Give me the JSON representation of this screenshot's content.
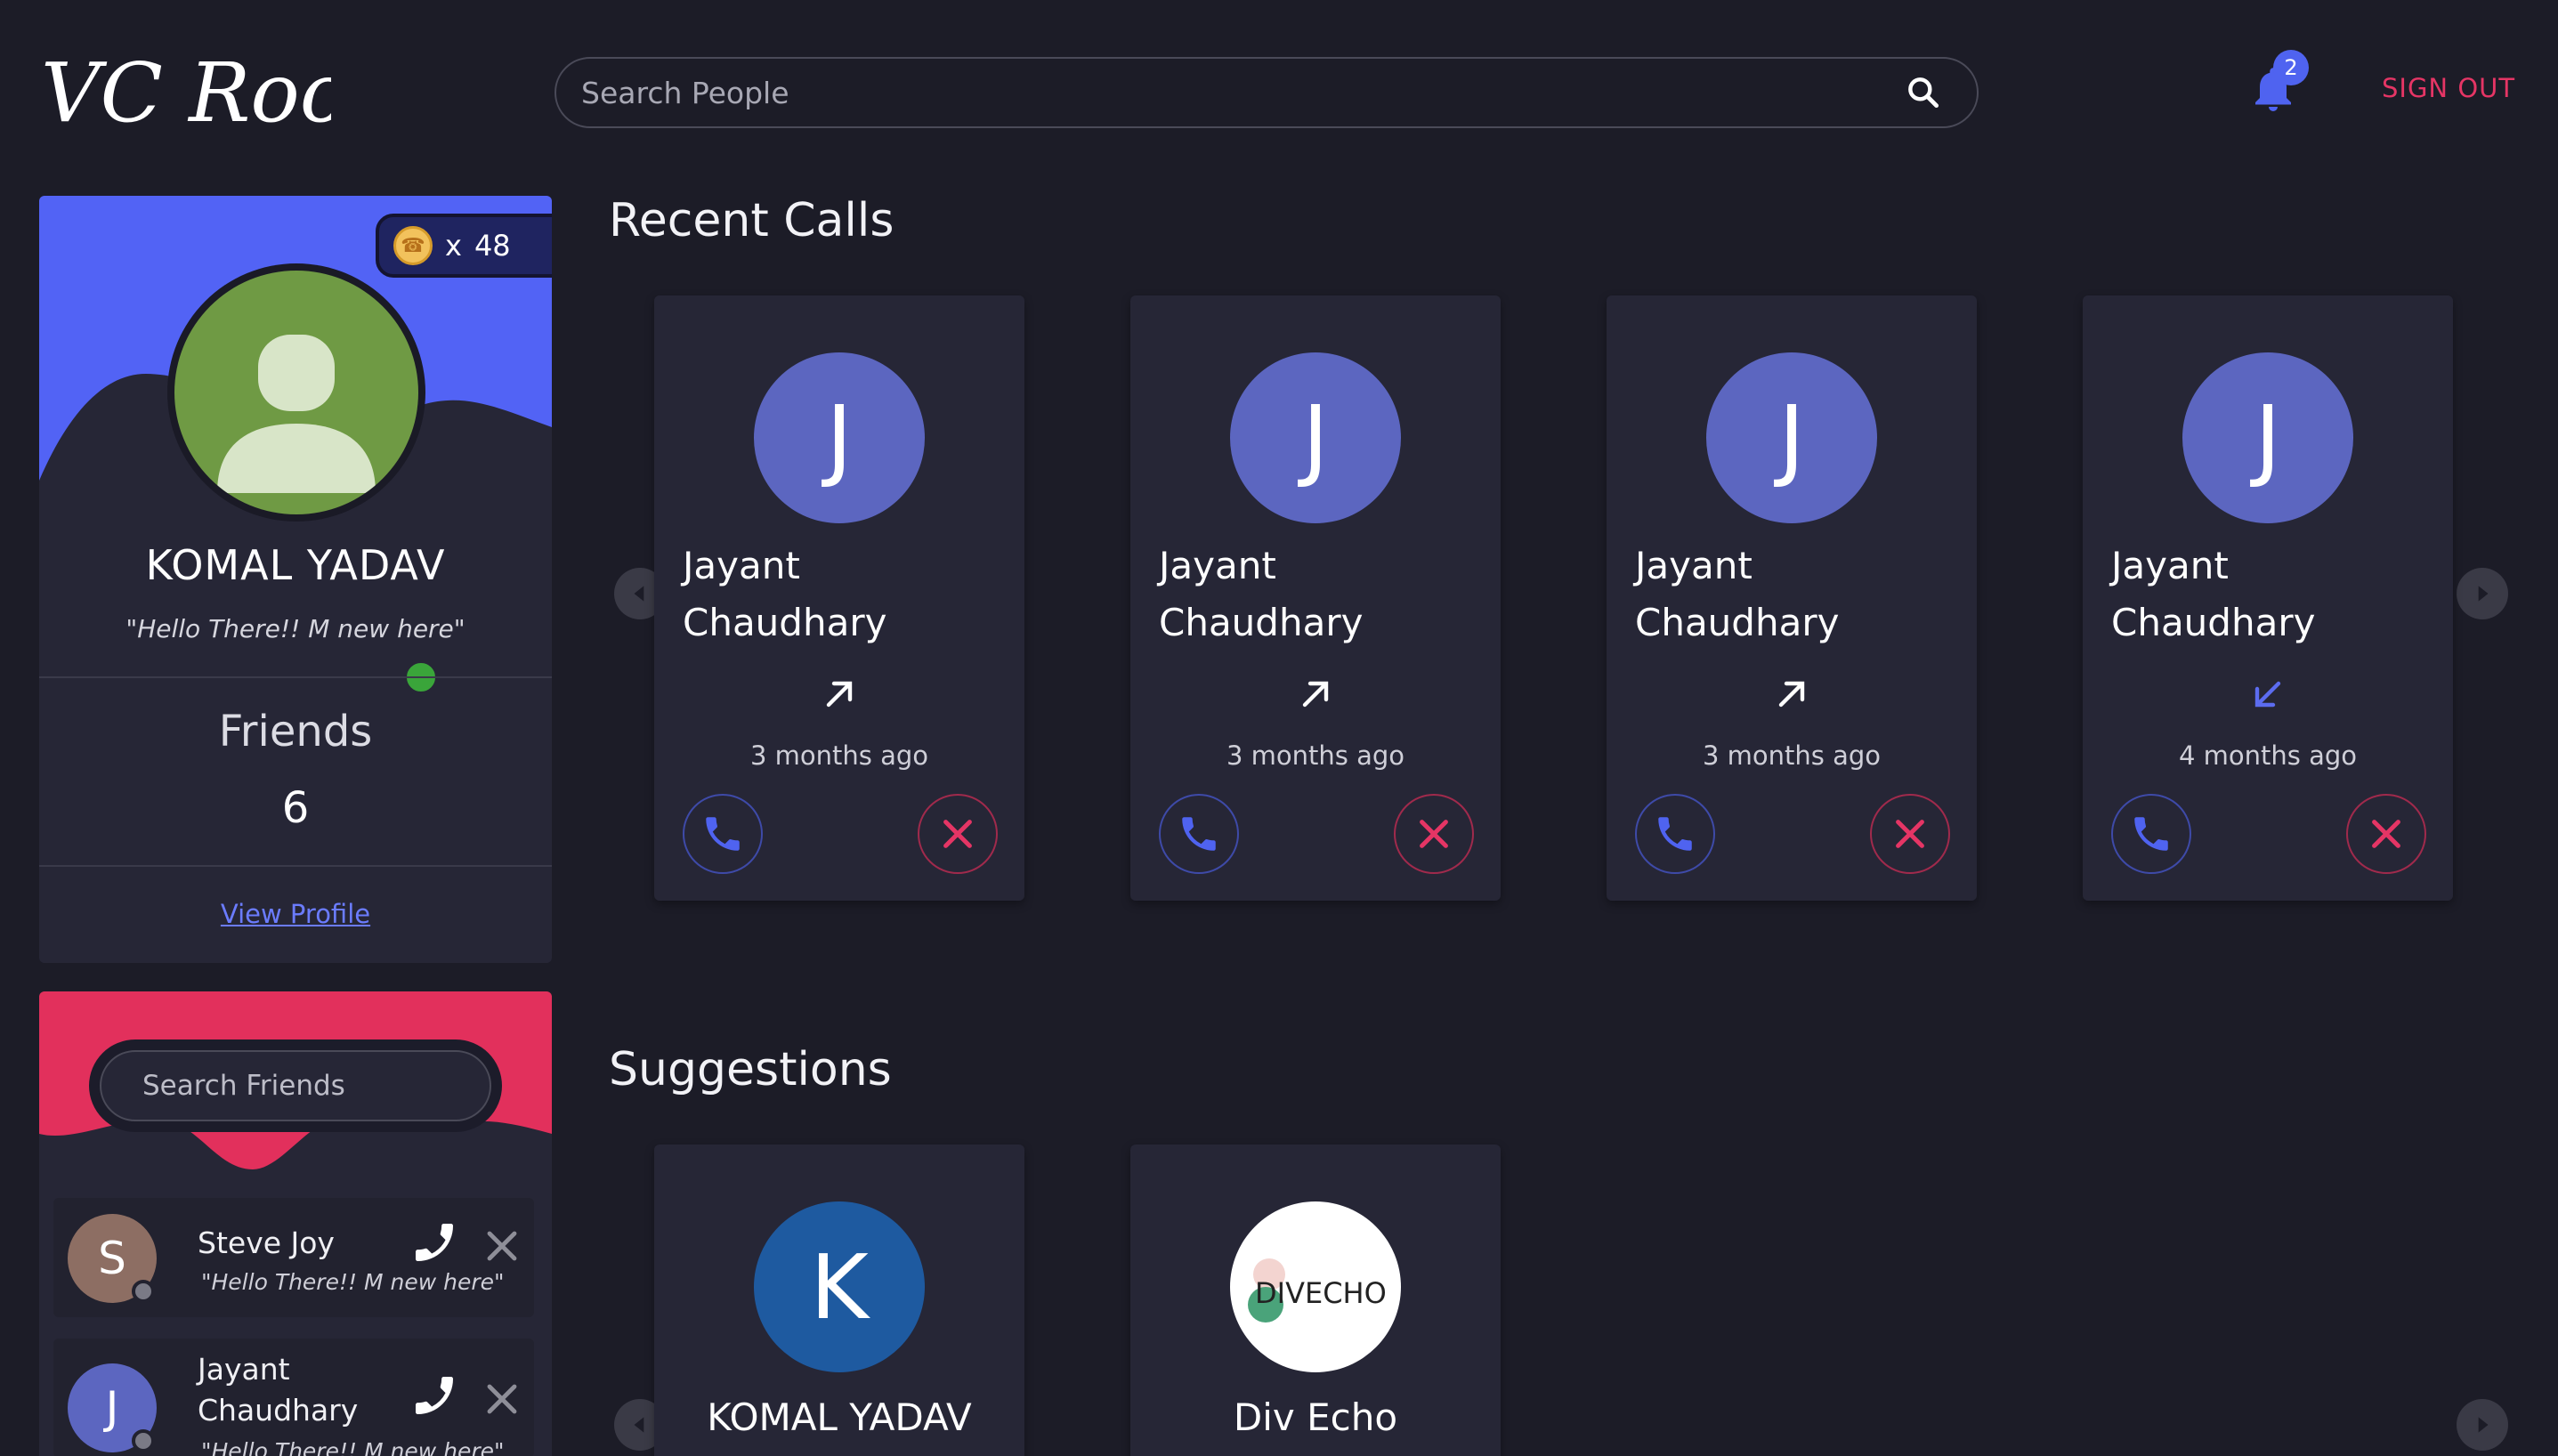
{
  "header": {
    "logo_text": "VC Room",
    "search_placeholder": "Search People",
    "notification_count": "2",
    "signout_label": "SIGN OUT"
  },
  "profile": {
    "coin_multiplier": "x",
    "coin_count": "48",
    "name": "KOMAL YADAV",
    "status": "\"Hello There!! M new here\"",
    "friends_label": "Friends",
    "friends_count": "6",
    "view_profile_label": "View Profile"
  },
  "friends_panel": {
    "search_placeholder": "Search Friends",
    "items": [
      {
        "initial": "S",
        "name_line1": "Steve Joy",
        "name_line2": "",
        "status": "\"Hello There!! M new here\"",
        "avatar_color": "#8d6e63"
      },
      {
        "initial": "J",
        "name_line1": "Jayant",
        "name_line2": "Chaudhary",
        "status": "\"Hello There!! M new here\"",
        "avatar_color": "#5c66c0"
      }
    ]
  },
  "recent_calls": {
    "title": "Recent Calls",
    "items": [
      {
        "initial": "J",
        "first": "Jayant",
        "last": "Chaudhary",
        "direction": "outgoing",
        "time": "3 months ago"
      },
      {
        "initial": "J",
        "first": "Jayant",
        "last": "Chaudhary",
        "direction": "outgoing",
        "time": "3 months ago"
      },
      {
        "initial": "J",
        "first": "Jayant",
        "last": "Chaudhary",
        "direction": "outgoing",
        "time": "3 months ago"
      },
      {
        "initial": "J",
        "first": "Jayant",
        "last": "Chaudhary",
        "direction": "incoming",
        "time": "4 months ago"
      }
    ]
  },
  "suggestions": {
    "title": "Suggestions",
    "items": [
      {
        "initial": "K",
        "name": "KOMAL YADAV",
        "avatar_color": "#1e5aa0"
      },
      {
        "initial": "",
        "name": "Div Echo",
        "logo_text": "DIVECHO",
        "avatar_color": "#ffffff"
      }
    ]
  },
  "colors": {
    "background": "#1c1c27",
    "card": "#262636",
    "accent_blue": "#4f63f0",
    "accent_red": "#e53565",
    "avatar_purple": "#5c66c0"
  }
}
